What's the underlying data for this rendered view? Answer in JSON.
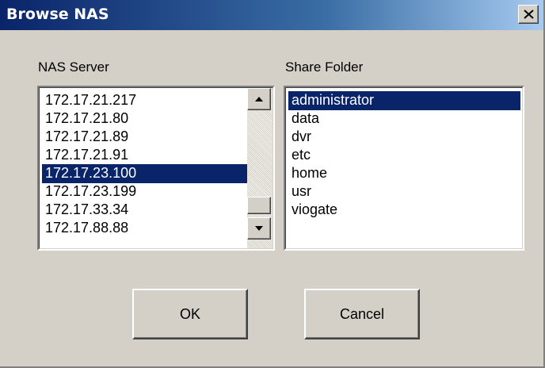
{
  "window": {
    "title": "Browse NAS"
  },
  "nas_server": {
    "label": "NAS Server",
    "items": [
      "172.17.21.217",
      "172.17.21.80",
      "172.17.21.89",
      "172.17.21.91",
      "172.17.23.100",
      "172.17.23.199",
      "172.17.33.34",
      "172.17.88.88"
    ],
    "selected": "172.17.23.100"
  },
  "share_folder": {
    "label": "Share Folder",
    "items": [
      "administrator",
      "data",
      "dvr",
      "etc",
      "home",
      "usr",
      "viogate"
    ],
    "selected": "administrator"
  },
  "buttons": {
    "ok": "OK",
    "cancel": "Cancel"
  }
}
